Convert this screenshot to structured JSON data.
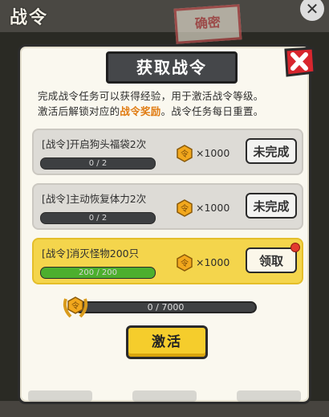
{
  "background": {
    "title": "战令",
    "stamp": "确密"
  },
  "dialog": {
    "title": "获取战令",
    "desc_line1": "完成战令任务可以获得经验，用于激活战令等级。",
    "desc_line2_a": "激活后解锁对应的",
    "desc_line2_highlight": "战令奖励",
    "desc_line2_b": "。战令任务每日重置。"
  },
  "tasks": [
    {
      "name": "[战令]开启狗头福袋2次",
      "progress_text": "0 / 2",
      "progress": 0,
      "reward": "×1000",
      "button": "未完成",
      "status": "incomplete"
    },
    {
      "name": "[战令]主动恢复体力2次",
      "progress_text": "0 / 2",
      "progress": 0,
      "reward": "×1000",
      "button": "未完成",
      "status": "incomplete"
    },
    {
      "name": "[战令]消灭怪物200只",
      "progress_text": "200 / 200",
      "progress": 1,
      "reward": "×1000",
      "button": "领取",
      "status": "claimable"
    }
  ],
  "experience": {
    "text": "0 / 7000",
    "current": 0,
    "max": 7000
  },
  "activate_button": "激活",
  "colors": {
    "accent": "#f5cd2c",
    "highlight": "#e07a10",
    "progress_fill": "#4caf2e",
    "close_red": "#d8262e"
  },
  "icons": {
    "coin": "token-coin-icon",
    "badge": "laurel-badge-icon",
    "close": "close-x-icon"
  }
}
